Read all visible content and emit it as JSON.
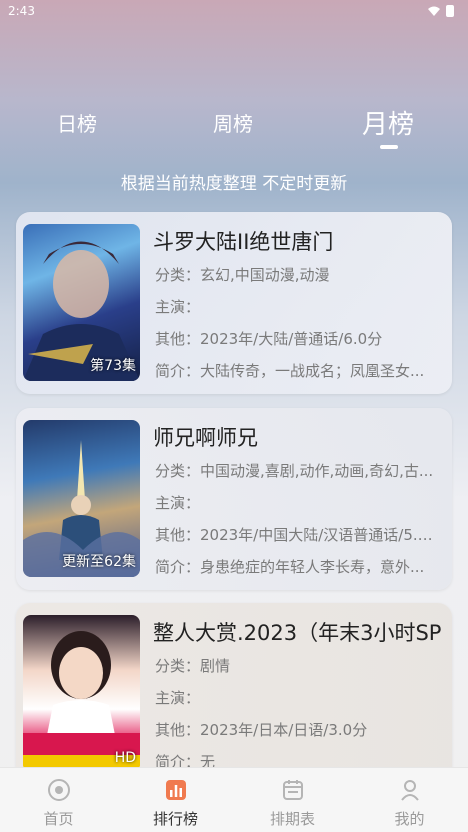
{
  "status_bar": {
    "time": "2:43"
  },
  "tabs": [
    {
      "label": "日榜"
    },
    {
      "label": "周榜"
    },
    {
      "label": "月榜",
      "active": true
    }
  ],
  "subtitle": "根据当前热度整理 不定时更新",
  "items": [
    {
      "title": "斗罗大陆II绝世唐门",
      "badge": "第73集",
      "category": "分类：玄幻,中国动漫,动漫",
      "cast": "主演：",
      "other": "其他：2023年/大陆/普通话/6.0分",
      "intro": "简介：大陆传奇，一战成名；凤凰圣女..."
    },
    {
      "title": "师兄啊师兄",
      "badge": "更新至62集",
      "category": "分类：中国动漫,喜剧,动作,动画,奇幻,古...",
      "cast": "主演：",
      "other": "其他：2023年/中国大陆/汉语普通话/5.0...",
      "intro": "简介：身患绝症的年轻人李长寿，意外..."
    },
    {
      "title": "整人大赏.2023（年末3小时SP",
      "badge": "HD",
      "category": "分类：剧情",
      "cast": "主演：",
      "other": "其他：2023年/日本/日语/3.0分",
      "intro": "简介：无"
    }
  ],
  "nav": [
    {
      "label": "首页",
      "icon": "home-icon"
    },
    {
      "label": "排行榜",
      "icon": "ranking-icon",
      "active": true
    },
    {
      "label": "排期表",
      "icon": "calendar-icon"
    },
    {
      "label": "我的",
      "icon": "profile-icon"
    }
  ],
  "colors": {
    "active_nav": "#333333",
    "inactive_nav": "#9a9a9a",
    "tab_text": "#ffffff"
  }
}
